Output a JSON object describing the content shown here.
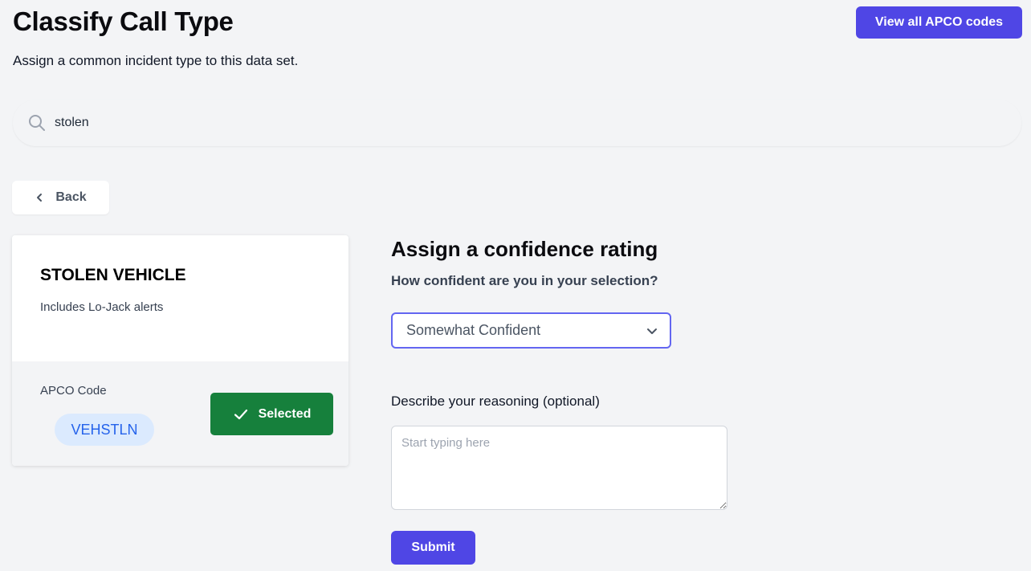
{
  "header": {
    "title": "Classify Call Type",
    "subtitle": "Assign a common incident type to this data set.",
    "view_all_label": "View all APCO codes"
  },
  "search": {
    "value": "stolen",
    "icon": "search-icon"
  },
  "back": {
    "label": "Back",
    "icon": "chevron-left-icon"
  },
  "incident_card": {
    "title": "STOLEN VEHICLE",
    "description": "Includes Lo-Jack alerts",
    "apco_label": "APCO Code",
    "apco_code": "VEHSTLN",
    "selected_label": "Selected",
    "selected_icon": "check-icon"
  },
  "confidence": {
    "heading": "Assign a confidence rating",
    "question": "How confident are you in your selection?",
    "selected_value": "Somewhat Confident",
    "dropdown_icon": "chevron-down-icon"
  },
  "reasoning": {
    "label": "Describe your reasoning (optional)",
    "placeholder": "Start typing here",
    "value": ""
  },
  "submit": {
    "label": "Submit"
  },
  "colors": {
    "primary": "#4f46e5",
    "success": "#16803c",
    "pill_bg": "#dbeafe",
    "pill_text": "#2563eb",
    "page_bg": "#f3f4f6"
  }
}
